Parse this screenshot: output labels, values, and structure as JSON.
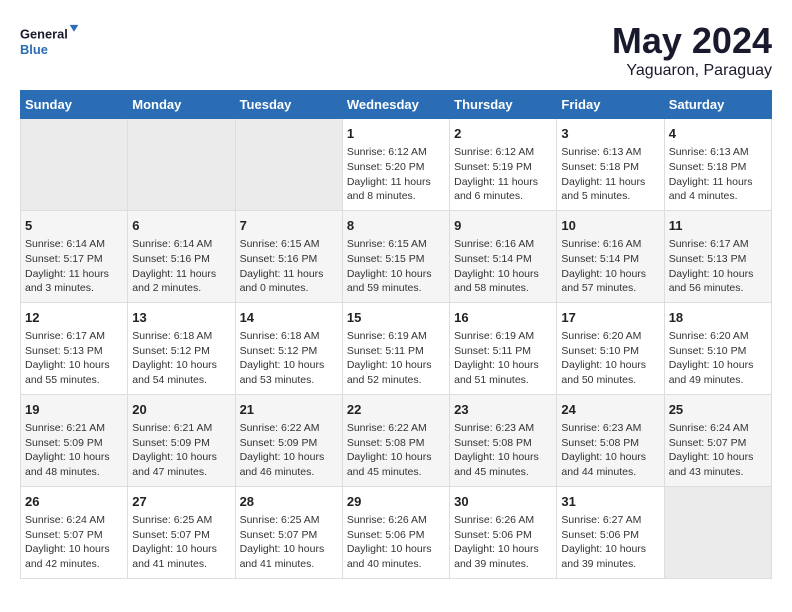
{
  "header": {
    "logo_line1": "General",
    "logo_line2": "Blue",
    "month": "May 2024",
    "location": "Yaguaron, Paraguay"
  },
  "weekdays": [
    "Sunday",
    "Monday",
    "Tuesday",
    "Wednesday",
    "Thursday",
    "Friday",
    "Saturday"
  ],
  "weeks": [
    [
      {
        "day": "",
        "info": ""
      },
      {
        "day": "",
        "info": ""
      },
      {
        "day": "",
        "info": ""
      },
      {
        "day": "1",
        "info": "Sunrise: 6:12 AM\nSunset: 5:20 PM\nDaylight: 11 hours and 8 minutes."
      },
      {
        "day": "2",
        "info": "Sunrise: 6:12 AM\nSunset: 5:19 PM\nDaylight: 11 hours and 6 minutes."
      },
      {
        "day": "3",
        "info": "Sunrise: 6:13 AM\nSunset: 5:18 PM\nDaylight: 11 hours and 5 minutes."
      },
      {
        "day": "4",
        "info": "Sunrise: 6:13 AM\nSunset: 5:18 PM\nDaylight: 11 hours and 4 minutes."
      }
    ],
    [
      {
        "day": "5",
        "info": "Sunrise: 6:14 AM\nSunset: 5:17 PM\nDaylight: 11 hours and 3 minutes."
      },
      {
        "day": "6",
        "info": "Sunrise: 6:14 AM\nSunset: 5:16 PM\nDaylight: 11 hours and 2 minutes."
      },
      {
        "day": "7",
        "info": "Sunrise: 6:15 AM\nSunset: 5:16 PM\nDaylight: 11 hours and 0 minutes."
      },
      {
        "day": "8",
        "info": "Sunrise: 6:15 AM\nSunset: 5:15 PM\nDaylight: 10 hours and 59 minutes."
      },
      {
        "day": "9",
        "info": "Sunrise: 6:16 AM\nSunset: 5:14 PM\nDaylight: 10 hours and 58 minutes."
      },
      {
        "day": "10",
        "info": "Sunrise: 6:16 AM\nSunset: 5:14 PM\nDaylight: 10 hours and 57 minutes."
      },
      {
        "day": "11",
        "info": "Sunrise: 6:17 AM\nSunset: 5:13 PM\nDaylight: 10 hours and 56 minutes."
      }
    ],
    [
      {
        "day": "12",
        "info": "Sunrise: 6:17 AM\nSunset: 5:13 PM\nDaylight: 10 hours and 55 minutes."
      },
      {
        "day": "13",
        "info": "Sunrise: 6:18 AM\nSunset: 5:12 PM\nDaylight: 10 hours and 54 minutes."
      },
      {
        "day": "14",
        "info": "Sunrise: 6:18 AM\nSunset: 5:12 PM\nDaylight: 10 hours and 53 minutes."
      },
      {
        "day": "15",
        "info": "Sunrise: 6:19 AM\nSunset: 5:11 PM\nDaylight: 10 hours and 52 minutes."
      },
      {
        "day": "16",
        "info": "Sunrise: 6:19 AM\nSunset: 5:11 PM\nDaylight: 10 hours and 51 minutes."
      },
      {
        "day": "17",
        "info": "Sunrise: 6:20 AM\nSunset: 5:10 PM\nDaylight: 10 hours and 50 minutes."
      },
      {
        "day": "18",
        "info": "Sunrise: 6:20 AM\nSunset: 5:10 PM\nDaylight: 10 hours and 49 minutes."
      }
    ],
    [
      {
        "day": "19",
        "info": "Sunrise: 6:21 AM\nSunset: 5:09 PM\nDaylight: 10 hours and 48 minutes."
      },
      {
        "day": "20",
        "info": "Sunrise: 6:21 AM\nSunset: 5:09 PM\nDaylight: 10 hours and 47 minutes."
      },
      {
        "day": "21",
        "info": "Sunrise: 6:22 AM\nSunset: 5:09 PM\nDaylight: 10 hours and 46 minutes."
      },
      {
        "day": "22",
        "info": "Sunrise: 6:22 AM\nSunset: 5:08 PM\nDaylight: 10 hours and 45 minutes."
      },
      {
        "day": "23",
        "info": "Sunrise: 6:23 AM\nSunset: 5:08 PM\nDaylight: 10 hours and 45 minutes."
      },
      {
        "day": "24",
        "info": "Sunrise: 6:23 AM\nSunset: 5:08 PM\nDaylight: 10 hours and 44 minutes."
      },
      {
        "day": "25",
        "info": "Sunrise: 6:24 AM\nSunset: 5:07 PM\nDaylight: 10 hours and 43 minutes."
      }
    ],
    [
      {
        "day": "26",
        "info": "Sunrise: 6:24 AM\nSunset: 5:07 PM\nDaylight: 10 hours and 42 minutes."
      },
      {
        "day": "27",
        "info": "Sunrise: 6:25 AM\nSunset: 5:07 PM\nDaylight: 10 hours and 41 minutes."
      },
      {
        "day": "28",
        "info": "Sunrise: 6:25 AM\nSunset: 5:07 PM\nDaylight: 10 hours and 41 minutes."
      },
      {
        "day": "29",
        "info": "Sunrise: 6:26 AM\nSunset: 5:06 PM\nDaylight: 10 hours and 40 minutes."
      },
      {
        "day": "30",
        "info": "Sunrise: 6:26 AM\nSunset: 5:06 PM\nDaylight: 10 hours and 39 minutes."
      },
      {
        "day": "31",
        "info": "Sunrise: 6:27 AM\nSunset: 5:06 PM\nDaylight: 10 hours and 39 minutes."
      },
      {
        "day": "",
        "info": ""
      }
    ]
  ]
}
